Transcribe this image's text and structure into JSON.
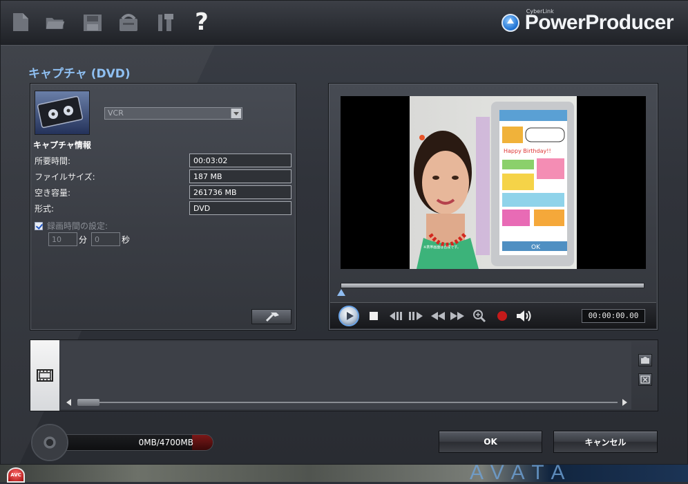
{
  "toolbar": {
    "icons": [
      "new-file-icon",
      "open-folder-icon",
      "save-icon",
      "burn-disc-icon",
      "tools-icon",
      "help-icon"
    ],
    "help_glyph": "?",
    "brand_small": "CyberLink",
    "brand_name": "PowerProducer"
  },
  "page": {
    "title": "キャプチャ (DVD)"
  },
  "capture": {
    "device_select": "VCR",
    "info_heading": "キャプチャ情報",
    "rows": [
      {
        "label": "所要時間:",
        "value": "00:03:02"
      },
      {
        "label": "ファイルサイズ:",
        "value": "187 MB"
      },
      {
        "label": "空き容量:",
        "value": "261736 MB"
      },
      {
        "label": "形式:",
        "value": "DVD"
      }
    ],
    "record_time_label": "録画時間の設定:",
    "record_time_checked": true,
    "minutes_value": "10",
    "minutes_unit": "分",
    "seconds_value": "0",
    "seconds_unit": "秒"
  },
  "player": {
    "timecode": "00:00:00.00",
    "controls": [
      "play-icon",
      "stop-icon",
      "step-back-icon",
      "step-forward-icon",
      "rewind-icon",
      "fast-forward-icon",
      "zoom-icon",
      "record-icon",
      "volume-icon"
    ],
    "video_phone_title": "Happy Birthday!!",
    "video_phone_ok": "OK",
    "video_caption": "※携帯画面は合成です。"
  },
  "status": {
    "capacity": "0MB/4700MB"
  },
  "buttons": {
    "ok": "OK",
    "cancel": "キャンセル"
  },
  "taskbar": {
    "app_icon_label": "AVC",
    "background_text": "AVATA"
  },
  "colors": {
    "accent_title": "#8fc0f2",
    "record_red": "#c41a1a"
  }
}
